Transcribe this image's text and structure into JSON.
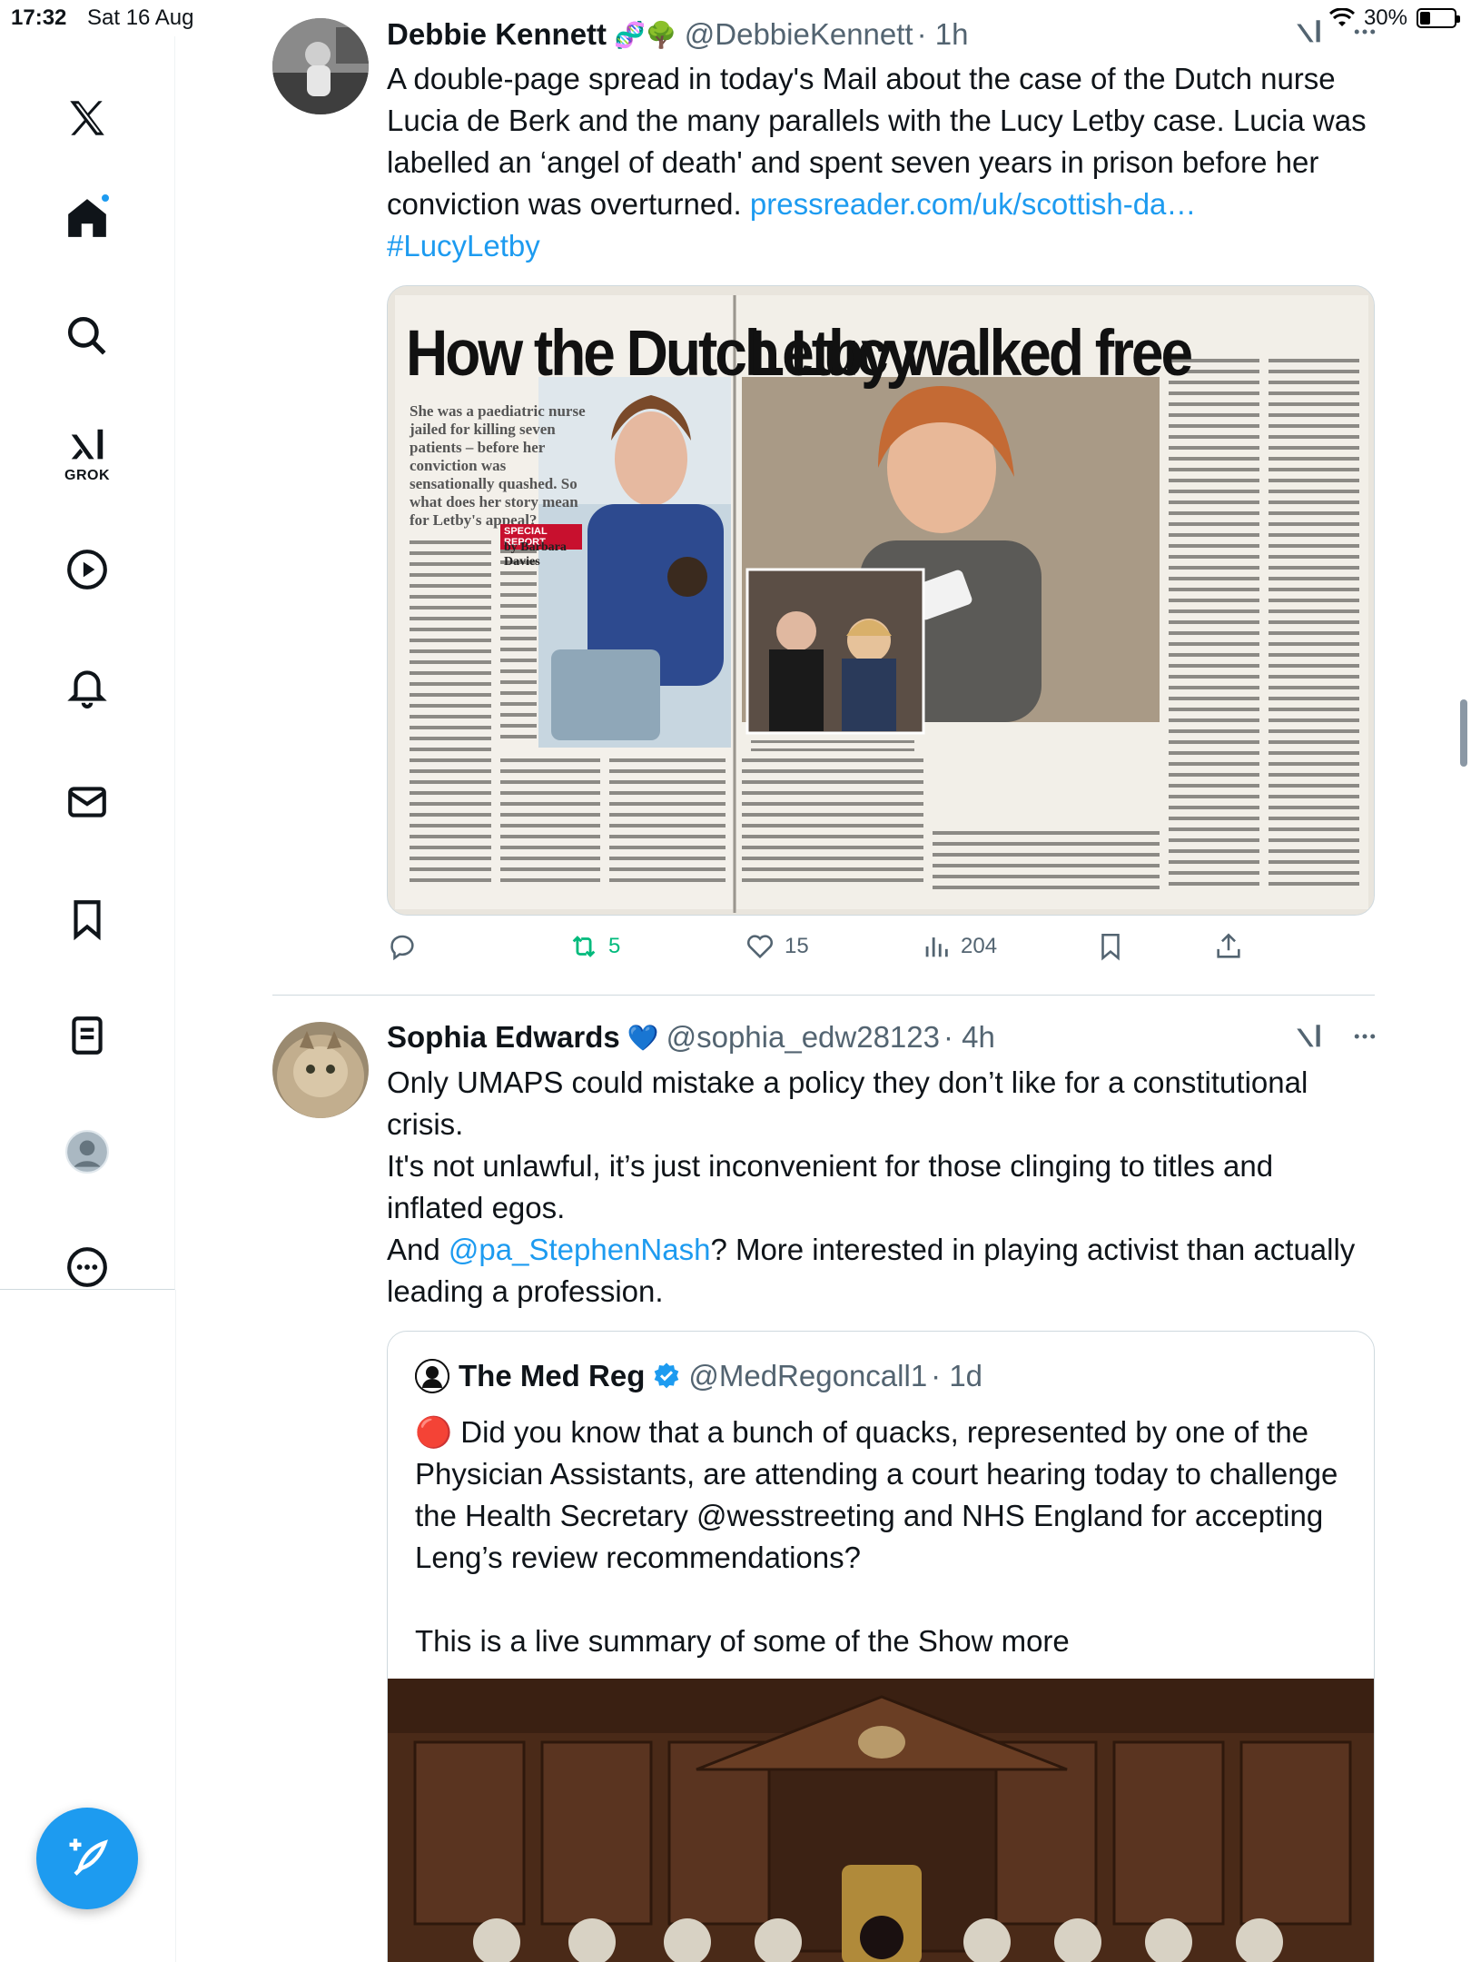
{
  "status": {
    "time": "17:32",
    "date": "Sat 16 Aug",
    "battery": "30%",
    "battery_level": 0.3
  },
  "sidebar": {
    "items": [
      {
        "name": "x-logo-icon"
      },
      {
        "name": "home-icon"
      },
      {
        "name": "search-icon"
      },
      {
        "name": "grok-icon",
        "label": "GROK"
      },
      {
        "name": "video-icon"
      },
      {
        "name": "notifications-icon"
      },
      {
        "name": "messages-icon"
      },
      {
        "name": "bookmarks-icon"
      },
      {
        "name": "lists-icon"
      },
      {
        "name": "profile-icon"
      },
      {
        "name": "more-icon"
      }
    ]
  },
  "tweet1": {
    "display_name": "Debbie Kennett",
    "emoji": "🧬🌳",
    "handle": "@DebbieKennett",
    "time": "· 1h",
    "text_main": "A double-page spread in today's Mail about the case of the Dutch nurse Lucia de Berk and the many parallels with the Lucy Letby case. Lucia was labelled an ‘angel of death' and spent seven years in prison before her conviction was overturned. ",
    "link": "pressreader.com/uk/scottish-da…",
    "hashtag": "#LucyLetby",
    "media": {
      "headline_left": "How the Dutch Lucy",
      "headline_right": "Letby walked free",
      "standfirst": "She was a paediatric nurse jailed for killing seven patients – before her conviction was sensationally quashed. So what does her story mean for Letby's appeal?",
      "special_report": "SPECIAL REPORT",
      "byline": "by Barbara Davies"
    },
    "actions": {
      "retweets": "5",
      "likes": "15",
      "views": "204"
    }
  },
  "tweet2": {
    "display_name": "Sophia Edwards",
    "emoji": "💙",
    "handle": "@sophia_edw28123",
    "time": "· 4h",
    "line1": "Only UMAPS could mistake a policy they don’t like for a constitutional crisis.",
    "line2": "It's not unlawful, it’s just inconvenient for those clinging to titles and inflated egos.",
    "line3_pre": "And ",
    "mention": "@pa_StephenNash",
    "line3_post": "? More interested in playing activist than actually leading a profession."
  },
  "quote": {
    "display_name": "The Med Reg",
    "handle": "@MedRegoncall1",
    "time": "· 1d",
    "emoji": "🔴",
    "text": " Did you know that a bunch of quacks, represented by one of the Physician Assistants, are attending a court hearing today to challenge the Health Secretary @wesstreeting and NHS England for accepting Leng’s review recommendations?",
    "text2": "This is a live summary of some of the ",
    "show_more": "Show more"
  },
  "colors": {
    "accent": "#1d9bf0",
    "retweet_green": "#00ba7c",
    "text": "#0f1419",
    "muted": "#536471"
  }
}
